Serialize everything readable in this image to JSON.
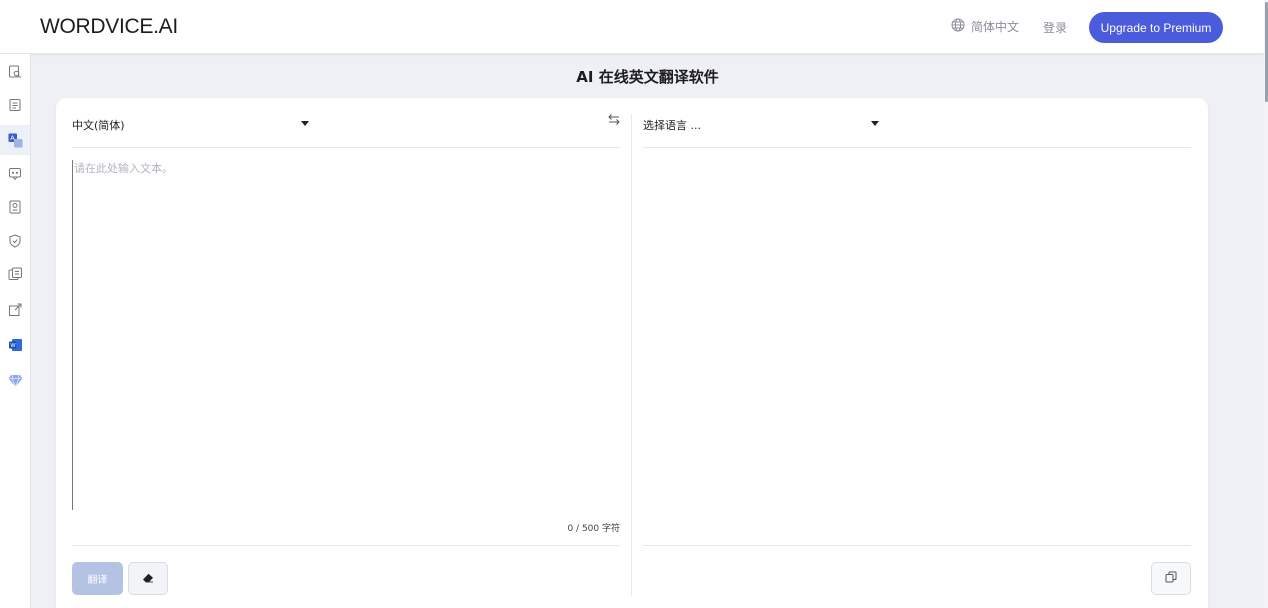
{
  "header": {
    "logo": "WORDVICE.AI",
    "language_label": "简体中文",
    "language_icon": "globe-icon",
    "login_label": "登录",
    "upgrade_label": "Upgrade to Premium"
  },
  "sidebar": {
    "items": [
      {
        "icon": "search-document-icon"
      },
      {
        "icon": "document-list-icon"
      },
      {
        "icon": "translate-icon",
        "active": true
      },
      {
        "icon": "chat-bubble-icon"
      },
      {
        "icon": "summary-icon"
      },
      {
        "icon": "shield-check-icon"
      },
      {
        "icon": "ai-detector-icon"
      },
      {
        "icon": "external-link-icon"
      },
      {
        "icon": "word-addin-icon"
      },
      {
        "icon": "premium-diamond-icon"
      }
    ]
  },
  "main": {
    "title": "AI 在线英文翻译软件",
    "source_language": "中文(简体)",
    "swap_icon": "swap-icon",
    "target_language_placeholder": "选择语言 ...",
    "input_placeholder": "请在此处输入文本。",
    "input_value": "",
    "char_count": "0 / 500 字符",
    "translate_button": "翻译",
    "erase_icon": "eraser-icon",
    "copy_icon": "copy-icon"
  },
  "colors": {
    "accent": "#4a5bdc",
    "translate_disabled": "#b4c3e3",
    "background": "#eef0f6"
  }
}
